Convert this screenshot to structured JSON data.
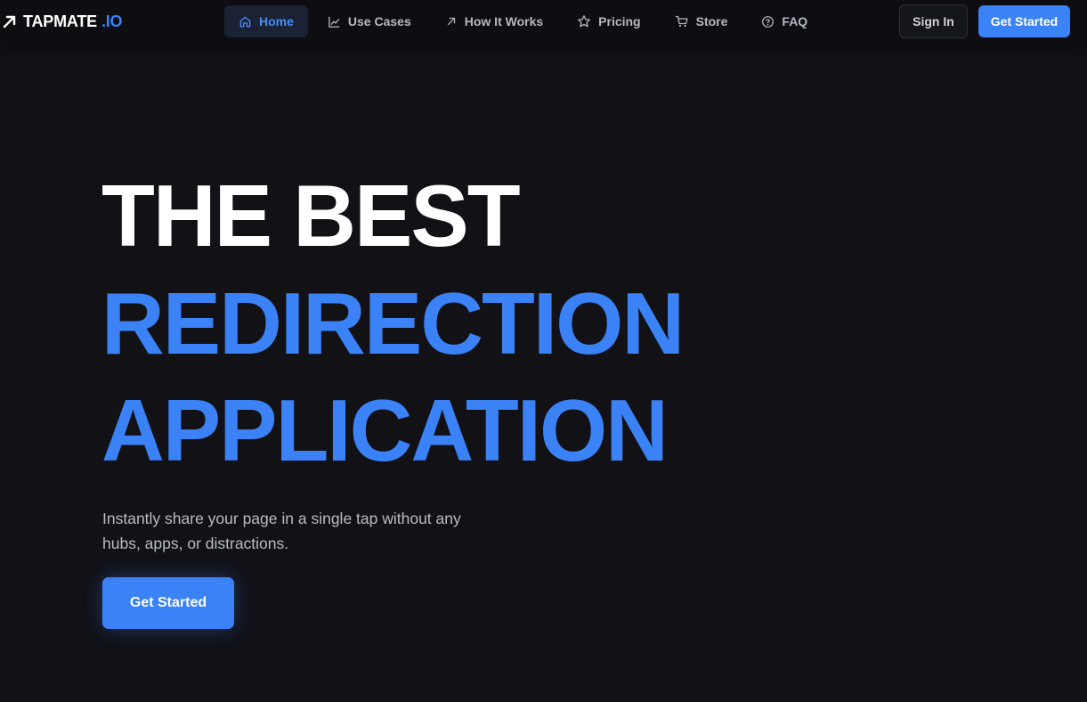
{
  "header": {
    "logo": {
      "icon": "arrow-up-right-icon",
      "name": "TAPMATE",
      "suffix": ".IO"
    },
    "nav": [
      {
        "label": "Home",
        "icon": "home-icon",
        "active": true
      },
      {
        "label": "Use Cases",
        "icon": "line-chart-icon",
        "active": false
      },
      {
        "label": "How It Works",
        "icon": "arrow-up-right-icon",
        "active": false
      },
      {
        "label": "Pricing",
        "icon": "star-icon",
        "active": false
      },
      {
        "label": "Store",
        "icon": "cart-icon",
        "active": false
      },
      {
        "label": "FAQ",
        "icon": "help-circle-icon",
        "active": false
      }
    ],
    "sign_in_label": "Sign In",
    "get_started_label": "Get Started"
  },
  "hero": {
    "line1": "THE BEST",
    "line2": "REDIRECTION",
    "line3": "APPLICATION",
    "subtitle": "Instantly share your page in a single tap without any hubs, apps, or distractions.",
    "cta_label": "Get Started"
  },
  "colors": {
    "background": "#111116",
    "accent": "#3b82f6",
    "text_primary": "#ffffff",
    "text_muted": "#b9bcc4"
  }
}
